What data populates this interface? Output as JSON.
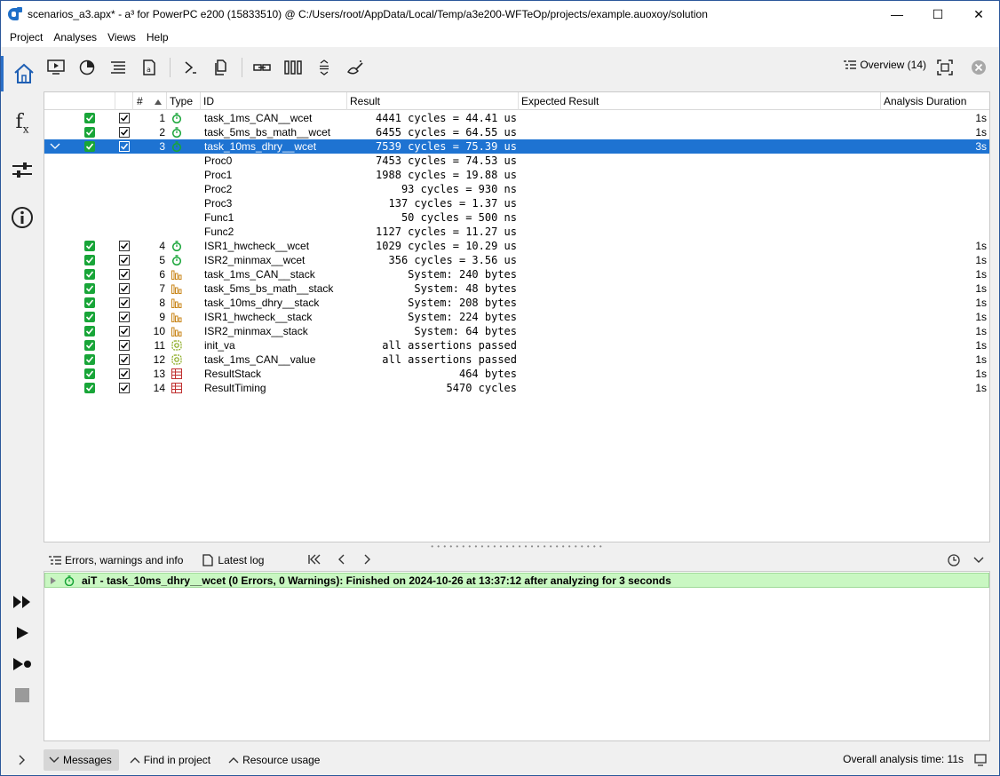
{
  "window": {
    "title": "scenarios_a3.apx* - a³ for PowerPC e200 (15833510) @ C:/Users/root/AppData/Local/Temp/a3e200-WFTeOp/projects/example.auoxoy/solution",
    "minimize": "—",
    "maximize": "☐",
    "close": "✕"
  },
  "menu": {
    "project": "Project",
    "analyses": "Analyses",
    "views": "Views",
    "help": "Help"
  },
  "toolbar": {
    "overview_label": "Overview (14)"
  },
  "table": {
    "columns": {
      "num": "#",
      "type": "Type",
      "id": "ID",
      "result": "Result",
      "expected": "Expected Result",
      "duration": "Analysis Duration"
    },
    "rows": [
      {
        "num": "1",
        "icon": "timer-icon",
        "id": "task_1ms_CAN__wcet",
        "result": "4441 cycles = 44.41 us",
        "duration": "1s"
      },
      {
        "num": "2",
        "icon": "timer-icon",
        "id": "task_5ms_bs_math__wcet",
        "result": "6455 cycles = 64.55 us",
        "duration": "1s"
      },
      {
        "num": "3",
        "icon": "timer-icon",
        "id": "task_10ms_dhry__wcet",
        "result": "7539 cycles = 75.39 us",
        "duration": "3s",
        "selected": true,
        "expanded": true
      },
      {
        "child": true,
        "id": "Proc0",
        "result": "7453 cycles = 74.53 us"
      },
      {
        "child": true,
        "id": "Proc1",
        "result": "1988 cycles = 19.88 us"
      },
      {
        "child": true,
        "id": "Proc2",
        "result": "93 cycles = 930 ns"
      },
      {
        "child": true,
        "id": "Proc3",
        "result": "137 cycles = 1.37 us"
      },
      {
        "child": true,
        "id": "Func1",
        "result": "50 cycles = 500 ns"
      },
      {
        "child": true,
        "id": "Func2",
        "result": "1127 cycles = 11.27 us"
      },
      {
        "num": "4",
        "icon": "timer-icon",
        "id": "ISR1_hwcheck__wcet",
        "result": "1029 cycles = 10.29 us",
        "duration": "1s"
      },
      {
        "num": "5",
        "icon": "timer-icon",
        "id": "ISR2_minmax__wcet",
        "result": "356 cycles = 3.56 us",
        "duration": "1s"
      },
      {
        "num": "6",
        "icon": "stack-bars-icon",
        "id": "task_1ms_CAN__stack",
        "result": "System: 240 bytes",
        "duration": "1s"
      },
      {
        "num": "7",
        "icon": "stack-bars-icon",
        "id": "task_5ms_bs_math__stack",
        "result": "System: 48 bytes",
        "duration": "1s"
      },
      {
        "num": "8",
        "icon": "stack-bars-icon",
        "id": "task_10ms_dhry__stack",
        "result": "System: 208 bytes",
        "duration": "1s"
      },
      {
        "num": "9",
        "icon": "stack-bars-icon",
        "id": "ISR1_hwcheck__stack",
        "result": "System: 224 bytes",
        "duration": "1s"
      },
      {
        "num": "10",
        "icon": "stack-bars-icon",
        "id": "ISR2_minmax__stack",
        "result": "System: 64 bytes",
        "duration": "1s"
      },
      {
        "num": "11",
        "icon": "value-gear-icon",
        "id": "init_va",
        "result": "all assertions passed",
        "duration": "1s"
      },
      {
        "num": "12",
        "icon": "value-gear-icon",
        "id": "task_1ms_CAN__value",
        "result": "all assertions passed",
        "duration": "1s"
      },
      {
        "num": "13",
        "icon": "report-table-icon",
        "id": "ResultStack",
        "result": "464 bytes",
        "duration": "1s"
      },
      {
        "num": "14",
        "icon": "report-table-icon",
        "id": "ResultTiming",
        "result": "5470 cycles",
        "duration": "1s"
      }
    ]
  },
  "messages": {
    "tab_errors": "Errors, warnings and info",
    "tab_log": "Latest log",
    "line": "aiT - task_10ms_dhry__wcet (0 Errors, 0 Warnings): Finished on 2024-10-26 at 13:37:12 after analyzing for 3 seconds"
  },
  "statusbar": {
    "messages": "Messages",
    "find": "Find in project",
    "resource": "Resource usage",
    "overall": "Overall analysis time: 11s"
  },
  "colors": {
    "accent": "#1e73d2",
    "success_green": "#18a538",
    "message_bg": "#c9f7c2"
  }
}
